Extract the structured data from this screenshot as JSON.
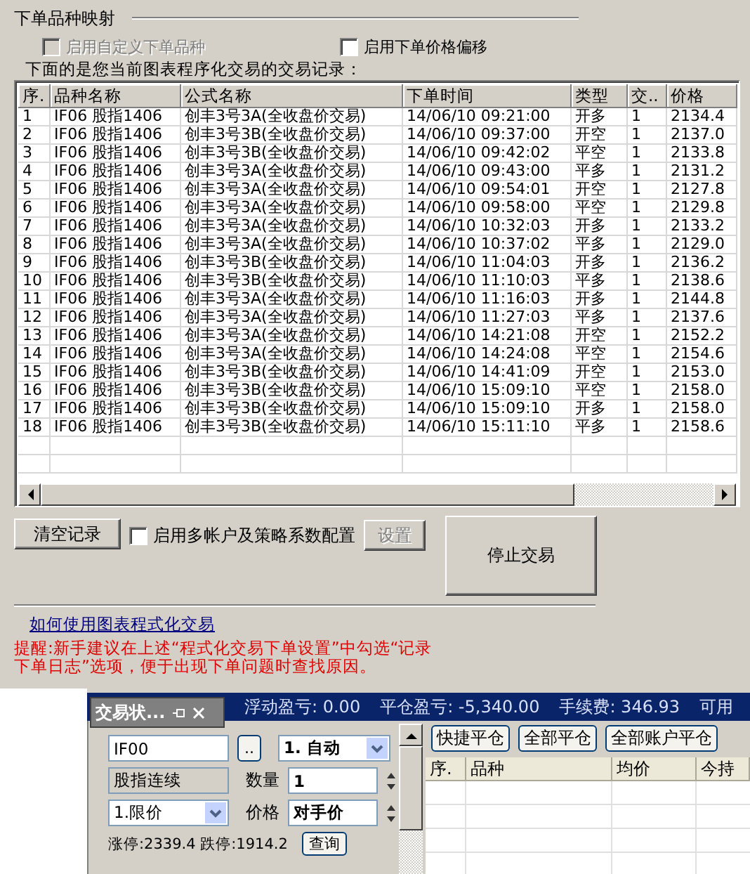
{
  "group_title": "下单品种映射",
  "options": [
    {
      "label": "启用自定义下单品种",
      "checked": false,
      "disabled": true
    },
    {
      "label": "启用下单价格偏移",
      "checked": false,
      "disabled": false
    }
  ],
  "records_caption": "下面的是您当前图表程序化交易的交易记录：",
  "table": {
    "columns": [
      "序.",
      "品种名称",
      "公式名称",
      "下单时间",
      "类型",
      "交..",
      "价格"
    ],
    "rows": [
      [
        "1",
        "IF06 股指1406",
        "创丰3号3A(全收盘价交易)",
        "14/06/10 09:21:00",
        "开多",
        "1",
        "2134.4"
      ],
      [
        "2",
        "IF06 股指1406",
        "创丰3号3B(全收盘价交易)",
        "14/06/10 09:37:00",
        "开空",
        "1",
        "2137.0"
      ],
      [
        "3",
        "IF06 股指1406",
        "创丰3号3B(全收盘价交易)",
        "14/06/10 09:42:02",
        "平空",
        "1",
        "2133.8"
      ],
      [
        "4",
        "IF06 股指1406",
        "创丰3号3A(全收盘价交易)",
        "14/06/10 09:43:00",
        "平多",
        "1",
        "2131.2"
      ],
      [
        "5",
        "IF06 股指1406",
        "创丰3号3A(全收盘价交易)",
        "14/06/10 09:54:01",
        "开空",
        "1",
        "2127.8"
      ],
      [
        "6",
        "IF06 股指1406",
        "创丰3号3A(全收盘价交易)",
        "14/06/10 09:58:00",
        "平空",
        "1",
        "2129.8"
      ],
      [
        "7",
        "IF06 股指1406",
        "创丰3号3A(全收盘价交易)",
        "14/06/10 10:32:03",
        "开多",
        "1",
        "2133.2"
      ],
      [
        "8",
        "IF06 股指1406",
        "创丰3号3A(全收盘价交易)",
        "14/06/10 10:37:02",
        "平多",
        "1",
        "2129.0"
      ],
      [
        "9",
        "IF06 股指1406",
        "创丰3号3B(全收盘价交易)",
        "14/06/10 11:04:03",
        "开多",
        "1",
        "2136.2"
      ],
      [
        "10",
        "IF06 股指1406",
        "创丰3号3B(全收盘价交易)",
        "14/06/10 11:10:03",
        "平多",
        "1",
        "2138.6"
      ],
      [
        "11",
        "IF06 股指1406",
        "创丰3号3A(全收盘价交易)",
        "14/06/10 11:16:03",
        "开多",
        "1",
        "2144.8"
      ],
      [
        "12",
        "IF06 股指1406",
        "创丰3号3A(全收盘价交易)",
        "14/06/10 11:27:03",
        "平多",
        "1",
        "2137.6"
      ],
      [
        "13",
        "IF06 股指1406",
        "创丰3号3A(全收盘价交易)",
        "14/06/10 14:21:08",
        "开空",
        "1",
        "2152.2"
      ],
      [
        "14",
        "IF06 股指1406",
        "创丰3号3A(全收盘价交易)",
        "14/06/10 14:24:08",
        "平空",
        "1",
        "2154.6"
      ],
      [
        "15",
        "IF06 股指1406",
        "创丰3号3B(全收盘价交易)",
        "14/06/10 14:41:09",
        "开空",
        "1",
        "2153.0"
      ],
      [
        "16",
        "IF06 股指1406",
        "创丰3号3B(全收盘价交易)",
        "14/06/10 15:09:10",
        "平空",
        "1",
        "2158.0"
      ],
      [
        "17",
        "IF06 股指1406",
        "创丰3号3B(全收盘价交易)",
        "14/06/10 15:09:10",
        "开多",
        "1",
        "2158.0"
      ],
      [
        "18",
        "IF06 股指1406",
        "创丰3号3B(全收盘价交易)",
        "14/06/10 15:11:10",
        "平多",
        "1",
        "2158.6"
      ]
    ]
  },
  "clear_button": "清空记录",
  "multi_account": {
    "label": "启用多帐户及策略系数配置",
    "checked": false
  },
  "settings_button": {
    "label": "设置",
    "disabled": true
  },
  "stop_button": "停止交易",
  "help_link": "如何使用图表程式化交易",
  "tip_lines": [
    "提醒:新手建议在上述“程式化交易下单设置”中勾选“记录",
    "下单日志”选项，便于出现下单问题时查找原因。"
  ],
  "account_bar": [
    {
      "label": "浮动盈亏:",
      "value": "0.00"
    },
    {
      "label": "平仓盈亏:",
      "value": "-5,340.00"
    },
    {
      "label": "手续费:",
      "value": "346.93"
    },
    {
      "label": "可用"
    }
  ],
  "dock_tab": {
    "title": "交易状..."
  },
  "order_form": {
    "symbol": "IF00",
    "browse": "..",
    "mode": "1. 自动",
    "product": "股指连续",
    "qty_label": "数量",
    "qty": "1",
    "price_type": "1.限价",
    "price_label": "价格",
    "price": "对手价",
    "limits": "涨停:2339.4 跌停:1914.2",
    "query": "查询"
  },
  "position_buttons": [
    "快捷平仓",
    "全部平仓",
    "全部账户平仓"
  ],
  "positions": {
    "columns": [
      "序.",
      "品种",
      "均价",
      "今持"
    ]
  }
}
